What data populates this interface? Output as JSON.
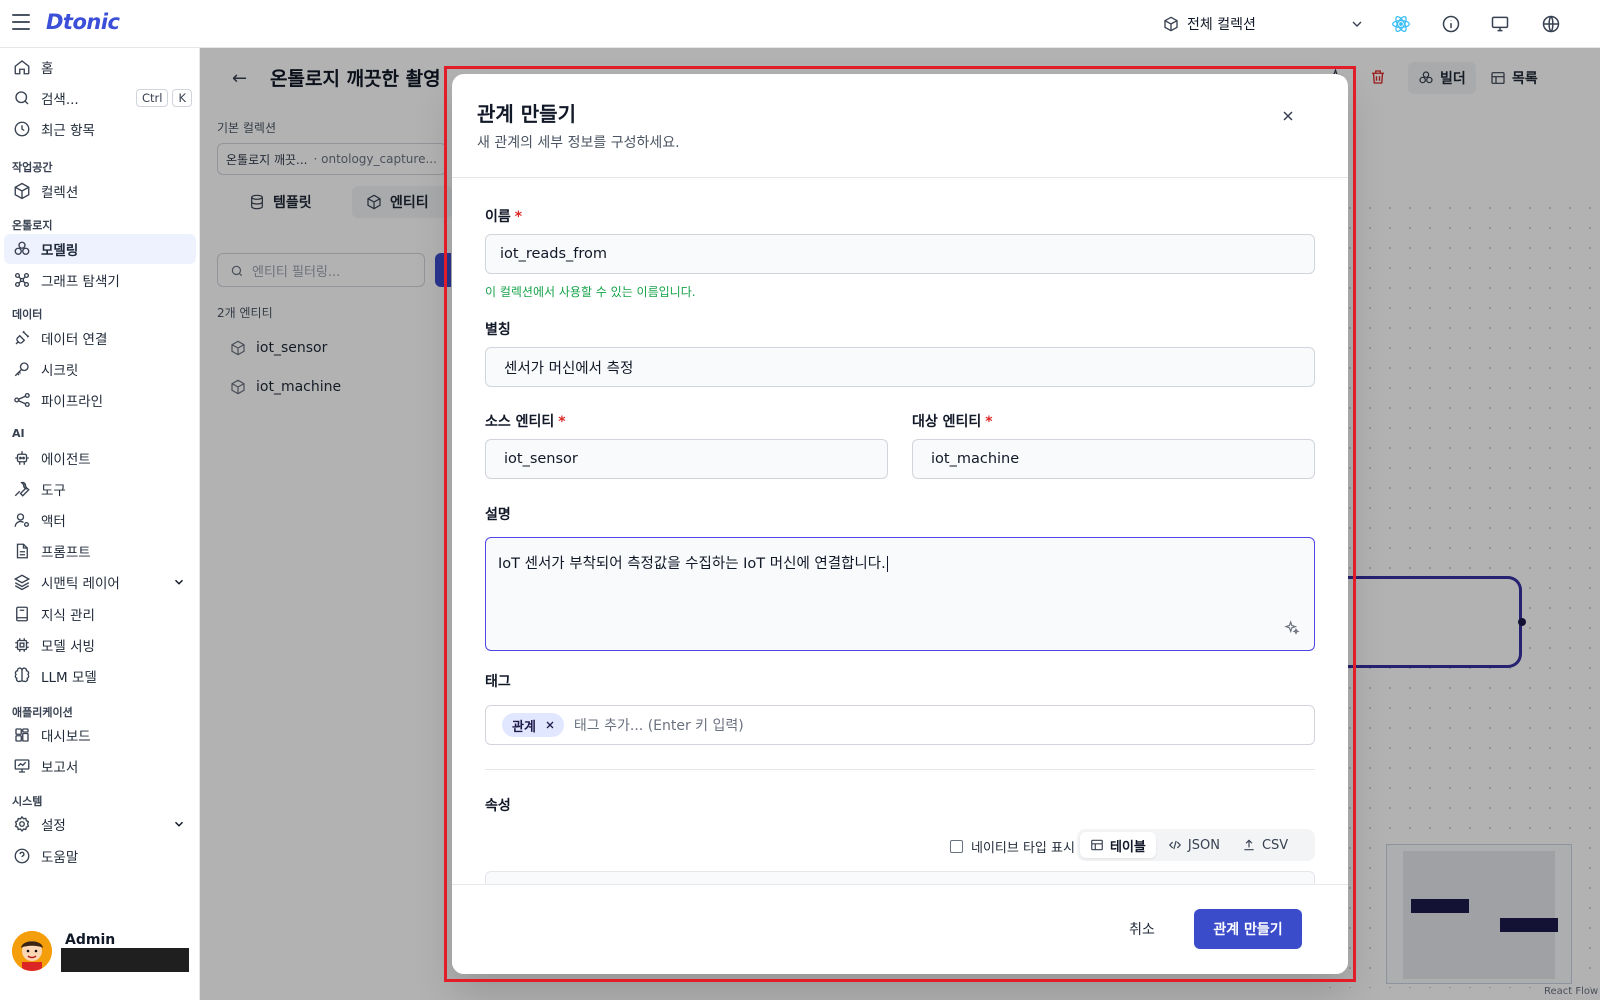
{
  "app": {
    "logo": "Dtonic"
  },
  "topbar": {
    "collection_label": "전체 컬렉션"
  },
  "sidebar": {
    "home": "홈",
    "search": "검색...",
    "search_kbd": [
      "Ctrl",
      "K"
    ],
    "recent": "최근 항목",
    "sections": {
      "workspace": "작업공간",
      "ontology": "온톨로지",
      "data": "데이터",
      "ai": "AI",
      "apps": "애플리케이션",
      "system": "시스템"
    },
    "items": {
      "collection": "컬렉션",
      "modeling": "모델링",
      "graph_explorer": "그래프 탐색기",
      "data_connection": "데이터 연결",
      "secrets": "시크릿",
      "pipeline": "파이프라인",
      "agent": "에이전트",
      "tools": "도구",
      "actor": "액터",
      "prompt": "프롬프트",
      "semantic_layer": "시맨틱 레이어",
      "knowledge": "지식 관리",
      "model_serving": "모델 서빙",
      "llm_model": "LLM 모델",
      "dashboard": "대시보드",
      "report": "보고서",
      "settings": "설정",
      "help": "도움말"
    },
    "user": {
      "name": "Admin"
    }
  },
  "background": {
    "page_title": "온톨로지 깨끗한 촬영",
    "base_collection_label": "기본 컬렉션",
    "base_collection_value": "온톨로지 깨끗...",
    "base_collection_id": "· ontology_capture...",
    "tabs": {
      "template": "템플릿",
      "entity": "엔티티"
    },
    "filter_placeholder": "엔티티 필터링...",
    "entity_count": "2개 엔티티",
    "entities": [
      "iot_sensor",
      "iot_machine"
    ],
    "builder": "빌더",
    "list": "목록",
    "react_flow": "React Flow"
  },
  "dialog": {
    "title": "관계 만들기",
    "subtitle": "새 관계의 세부 정보를 구성하세요.",
    "name_label": "이름",
    "name_value": "iot_reads_from",
    "name_hint": "이 컬렉션에서 사용할 수 있는 이름입니다.",
    "alias_label": "별칭",
    "alias_value": "센서가 머신에서 측정",
    "source_label": "소스 엔티티",
    "source_value": "iot_sensor",
    "target_label": "대상 엔티티",
    "target_value": "iot_machine",
    "desc_label": "설명",
    "desc_value": "IoT 센서가 부착되어 측정값을 수집하는 IoT 머신에 연결합니다.",
    "tags_label": "태그",
    "tags": [
      "관계"
    ],
    "tag_placeholder": "태그 추가... (Enter 키 입력)",
    "props_label": "속성",
    "native_type_label": "네이티브 타입 표시",
    "view_modes": {
      "table": "테이블",
      "json": "JSON",
      "csv": "CSV"
    },
    "cancel": "취소",
    "submit": "관계 만들기"
  },
  "colors": {
    "accent": "#3b4cca",
    "success": "#16a34a",
    "required": "#dc2626",
    "highlight": "#e11d2a"
  }
}
